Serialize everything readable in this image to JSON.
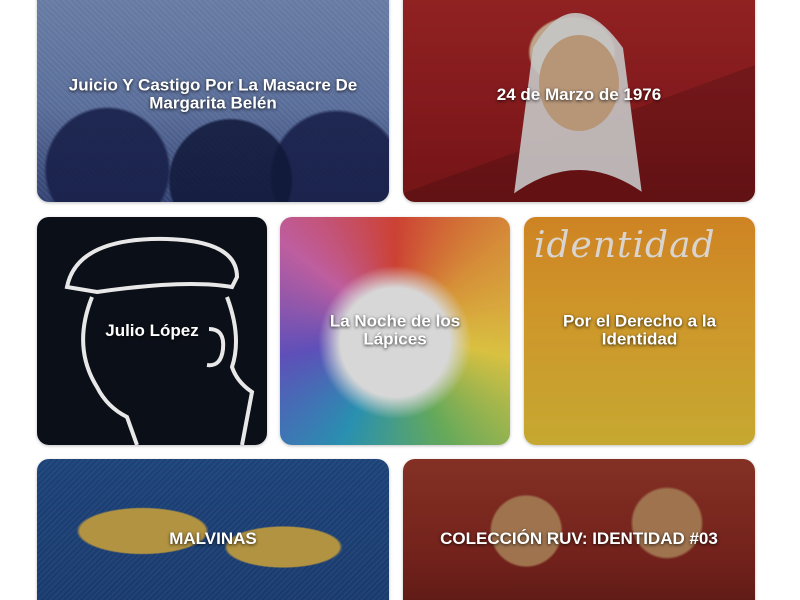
{
  "tiles": [
    {
      "id": "t1",
      "title": "Juicio Y Castigo Por La Masacre De Margarita Belén"
    },
    {
      "id": "t2",
      "title": "24 de Marzo de 1976"
    },
    {
      "id": "t3",
      "title": "Julio López"
    },
    {
      "id": "t4",
      "title": "La Noche de los Lápices"
    },
    {
      "id": "t5",
      "title": "Por el Derecho a la Identidad",
      "art_text": "identidad"
    },
    {
      "id": "t6",
      "title": "MALVINAS"
    },
    {
      "id": "t7",
      "title": "COLECCIÓN RUV: IDENTIDAD #03"
    }
  ],
  "colors": {
    "background": "#ffffff",
    "label_text": "#ffffff"
  }
}
